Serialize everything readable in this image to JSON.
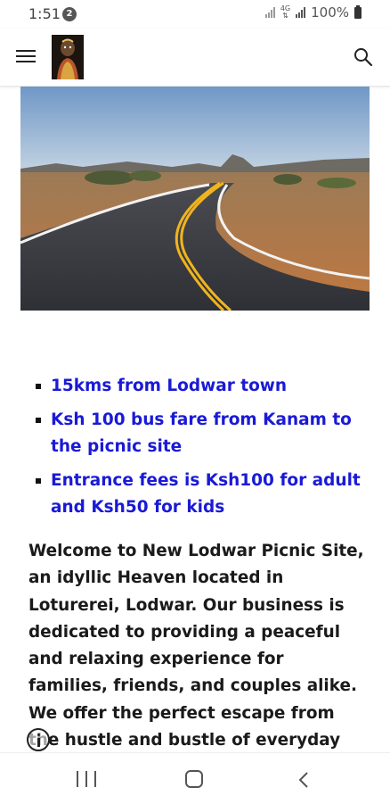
{
  "status_bar": {
    "time": "1:51",
    "notification_count": "2",
    "network": "4G",
    "battery": "100%"
  },
  "header": {
    "menu_icon": "hamburger-menu-icon",
    "logo": "site-logo",
    "search_icon": "search-icon"
  },
  "hero_image": {
    "description_icon": "road-photo"
  },
  "features": [
    "15kms from Lodwar town",
    "Ksh 100 bus fare from Kanam to the picnic site",
    "Entrance fees is Ksh100 for adult and Ksh50 for kids"
  ],
  "intro_text": "Welcome to New Lodwar Picnic Site, an idyllic Heaven located in Loturerei, Lodwar. Our business is dedicated to providing a peaceful and relaxing experience for families, friends, and couples alike. We offer the perfect escape from the hustle and bustle of everyday life, giving you a chance to",
  "colors": {
    "link_blue": "#1a1ad6",
    "text": "#1a1a1a"
  },
  "nav_bar": {
    "recents_icon": "recents-icon",
    "home_icon": "home-icon",
    "back_icon": "back-icon"
  }
}
